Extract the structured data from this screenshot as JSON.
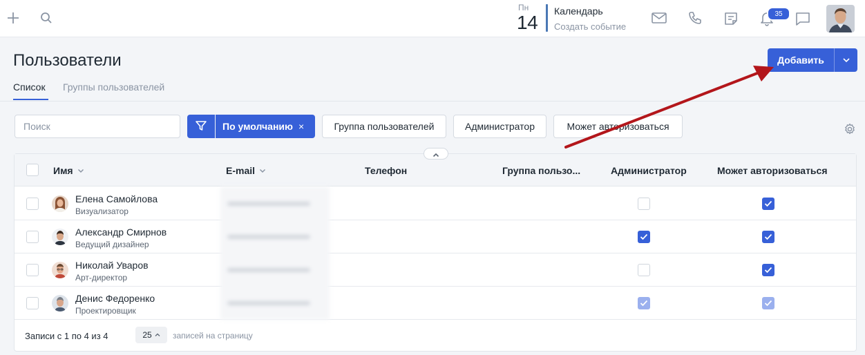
{
  "topbar": {
    "calendar": {
      "weekday": "Пн",
      "day": "14",
      "title": "Календарь",
      "subtitle": "Создать событие"
    },
    "notifications_count": "35"
  },
  "page": {
    "title": "Пользователи",
    "tabs": [
      {
        "label": "Список",
        "active": true
      },
      {
        "label": "Группы пользователей",
        "active": false
      }
    ],
    "add_button": "Добавить"
  },
  "filters": {
    "search_placeholder": "Поиск",
    "active_filter": "По умолчанию",
    "remove_mark": "×",
    "chips": [
      "Группа пользователей",
      "Администратор",
      "Может авторизоваться"
    ]
  },
  "table": {
    "columns": {
      "name": "Имя",
      "email": "E-mail",
      "phone": "Телефон",
      "group": "Группа пользо...",
      "admin": "Администратор",
      "can_login": "Может авторизоваться"
    },
    "rows": [
      {
        "name": "Елена Самойлова",
        "role": "Визуализатор",
        "admin": "off",
        "can_login": "on"
      },
      {
        "name": "Александр Смирнов",
        "role": "Ведущий дизайнер",
        "admin": "on",
        "can_login": "on"
      },
      {
        "name": "Николай Уваров",
        "role": "Арт-директор",
        "admin": "off",
        "can_login": "on"
      },
      {
        "name": "Денис Федоренко",
        "role": "Проектировщик",
        "admin": "dim",
        "can_login": "dim"
      }
    ],
    "footer": {
      "records": "Записи с 1 по 4 из 4",
      "per_page_value": "25",
      "per_page_label": "записей на страницу"
    }
  },
  "colors": {
    "accent": "#3760d8",
    "annotation_arrow": "#b3161b"
  }
}
